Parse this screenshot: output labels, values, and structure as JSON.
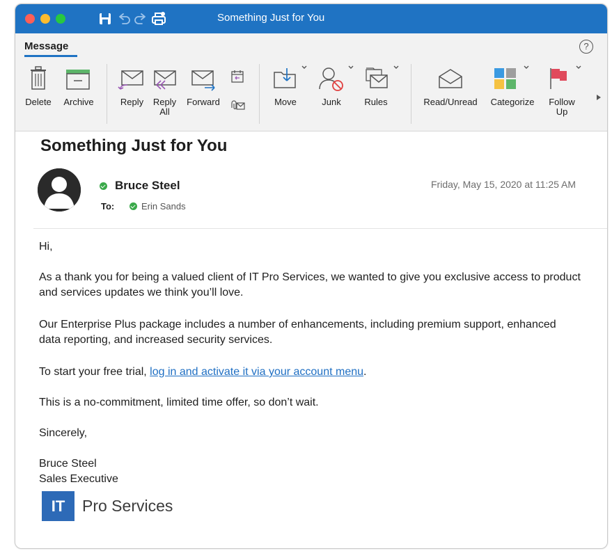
{
  "window": {
    "title": "Something Just for You",
    "accent_color": "#1f73c3"
  },
  "titlebar_icons": [
    "save-icon",
    "undo-icon",
    "redo-icon",
    "print-icon"
  ],
  "tabs": {
    "message": "Message",
    "help_symbol": "?"
  },
  "ribbon": {
    "delete": "Delete",
    "archive": "Archive",
    "reply": "Reply",
    "reply_all": "Reply\nAll",
    "forward": "Forward",
    "move": "Move",
    "junk": "Junk",
    "rules": "Rules",
    "read_unread": "Read/Unread",
    "categorize": "Categorize",
    "follow_up": "Follow\nUp"
  },
  "email": {
    "subject": "Something Just for You",
    "sender": "Bruce Steel",
    "to_label": "To:",
    "recipient": "Erin Sands",
    "date": "Friday, May 15, 2020 at 11:25 AM",
    "greeting": "Hi,",
    "para1": "As a thank you for being a valued client of IT Pro Services, we wanted to give you exclusive access to product and services updates we think you’ll love.",
    "para2": "Our Enterprise Plus package includes a number of enhancements, including premium support, enhanced data reporting, and increased security services.",
    "para3_prefix": "To start your free trial, ",
    "para3_link": "log in and activate it via your account menu",
    "para3_suffix": ".",
    "para4": "This is a no-commitment, limited time offer, so don’t wait.",
    "closing": "Sincerely,",
    "sig_name": "Bruce Steel",
    "sig_title": "Sales Executive",
    "logo_mark": "IT",
    "logo_text": "Pro Services"
  }
}
